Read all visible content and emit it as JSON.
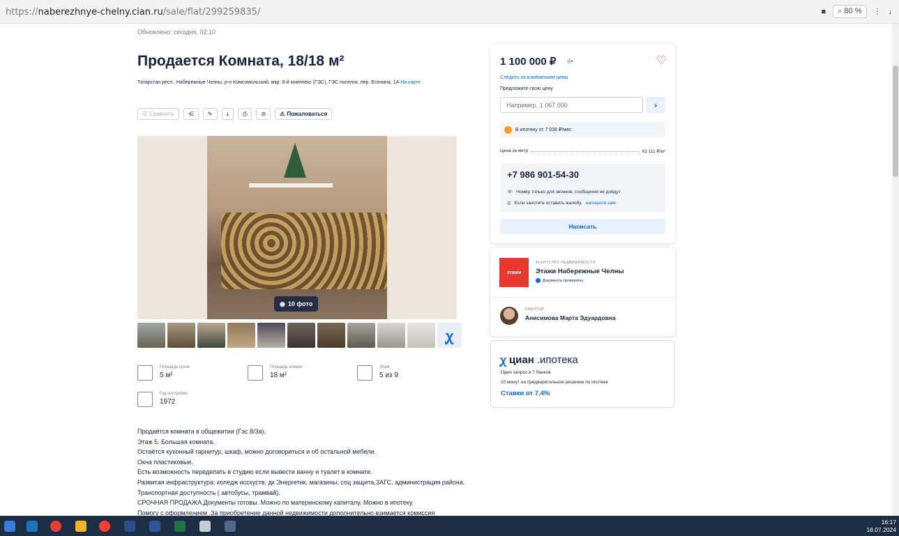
{
  "browser": {
    "url_prefix": "https://",
    "url_domain": "naberezhnye-chelny.cian.ru",
    "url_path": "/sale/flat/299259835/",
    "zoom": "80 %"
  },
  "listing": {
    "updated": "Обновлено: сегодня, 02:10",
    "title": "Продается Комната, 18/18 м²",
    "address": "Татарстан респ., Набережные Челны, р-н Комсомольский, мкр. 8-й комплекс (ГЭС), ГЭС поселок, пер. Есенина, 1А",
    "map_link": "На карте",
    "toolbar": {
      "compare": "Сравнить",
      "report": "Пожаловаться"
    },
    "photo_count": "10 фото",
    "features": [
      {
        "label": "Площадь кухни",
        "value": "5 м²"
      },
      {
        "label": "Площадь комнат",
        "value": "18 м²"
      },
      {
        "label": "Этаж",
        "value": "5 из 9"
      },
      {
        "label": "Год постройки",
        "value": "1972"
      }
    ],
    "description": [
      "Продаётся комната в общежитии (Гэс 8/3а).",
      "Этаж 5. Большая комната.",
      "Остаётся кухонный гарнитур, шкаф, можно договориться и об остальной мебели.",
      "Окна пластиковые.",
      "Есть возможность переделать в студию если вывести ванну и туалет в комнате.",
      "Развитая инфраструктура: коледж исскуств, дк Энергетик, магазины, соц защита,ЗАГС, администрация района. Транспортная доступность ( автобусы, трамвай).",
      "СРОЧНАЯ ПРОДАЖА.Документы готовы. Можно по материнскому капиталу. Можно в ипотеку.",
      "Помогу с оформлением .За приобретение данной недвижимости дополнительно взимается комиссия"
    ]
  },
  "price_card": {
    "price": "1 100 000 ₽",
    "follow_link": "Следить за изменением цены",
    "suggest_label": "Предложите свою цену",
    "input_placeholder": "Например, 1 067 000",
    "mortgage": "В ипотеку от 7 036 ₽/мес",
    "price_per_meter_label": "Цена за метр",
    "price_per_meter_value": "61 111 ₽/м²",
    "phone": "+7 986 901-54-30",
    "phone_note1": "Номер только для звонков, сообщения не дойдут",
    "phone_note2_text": "Если захотите оставить жалобу,",
    "phone_note2_link": "напишите нам",
    "write_button": "Написать"
  },
  "agency": {
    "label": "АГЕНТСТВО НЕДВИЖИМОСТИ",
    "logo_text": "этажи",
    "name": "Этажи Набережные Челны",
    "verified": "Документы проверены",
    "realtor_label": "РИЕЛТОР",
    "realtor_name": "Анисимова Марта Эдуардовна"
  },
  "cian": {
    "logo_bold": "циан",
    "logo_rest": ".ипотека",
    "line1": "Один запрос в 7 банков",
    "line2": "10 минут на предварительное решение по ипотеке",
    "rate": "Ставки от 7,4%"
  },
  "taskbar": {
    "time": "16:17",
    "date": "18.07.2024"
  },
  "colors": {
    "accent": "#0468ff",
    "text": "#152242",
    "heart": "#ff3c4c",
    "agency_logo": "#e8392e"
  }
}
